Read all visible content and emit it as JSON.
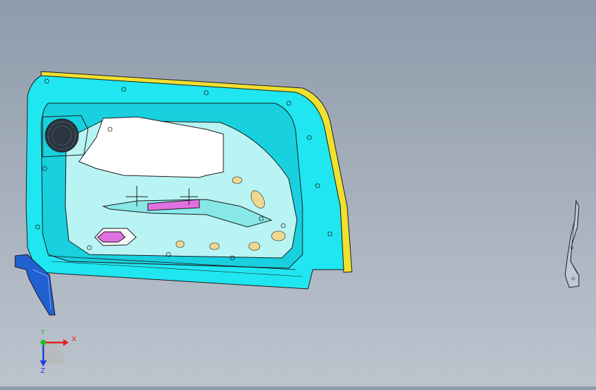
{
  "viewport": {
    "background_top": "#8f9bab",
    "background_bottom": "#bcc4ce"
  },
  "model": {
    "panel_color": "#1fe6f0",
    "panel_shade": "#14b8c8",
    "trim_color": "#f0e030",
    "insert_color": "#ffffff",
    "accent_color": "#e070e0",
    "pad_color": "#f0d890"
  },
  "triad": {
    "x_label": "X",
    "y_label": "Y",
    "z_label": "Z",
    "x_color": "#e02020",
    "y_color": "#20c020",
    "z_color": "#2040e0"
  }
}
